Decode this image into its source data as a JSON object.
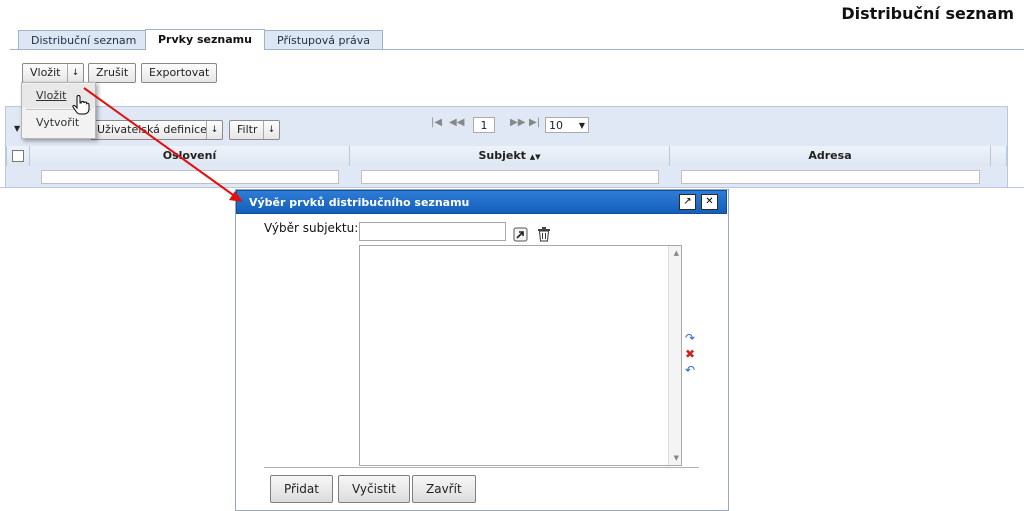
{
  "page": {
    "title": "Distribuční seznam"
  },
  "tabs": [
    {
      "label": "Distribuční seznam"
    },
    {
      "label": "Prvky seznamu"
    },
    {
      "label": "Přístupová práva"
    }
  ],
  "toolbar": {
    "insert_label": "Vložit",
    "cancel_label": "Zrušit",
    "export_label": "Exportovat"
  },
  "insert_menu": {
    "items": [
      "Vložit",
      "Vytvořit"
    ]
  },
  "grid_toolbar": {
    "user_def_label": "Uživatelská definice",
    "filter_label": "Filtr",
    "page_value": "1",
    "per_page": "10"
  },
  "grid": {
    "columns": [
      {
        "label": "Oslovení"
      },
      {
        "label": "Subjekt",
        "sort": "▲▼"
      },
      {
        "label": "Adresa"
      }
    ]
  },
  "dialog": {
    "title": "Výběr prvků distribučního seznamu",
    "subject_label": "Výběr subjektu:",
    "subject_value": "",
    "add_label": "Přidat",
    "clear_label": "Vyčistit",
    "close_label": "Zavřít"
  },
  "colors": {
    "accent": "#1a64c0",
    "arrow": "#e01010"
  }
}
